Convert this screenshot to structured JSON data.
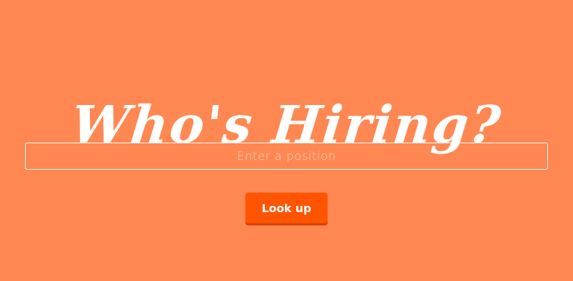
{
  "header": {
    "title": "Who's Hiring?"
  },
  "search": {
    "value": "",
    "placeholder": "Enter a position"
  },
  "actions": {
    "lookup_label": "Look up"
  },
  "colors": {
    "background": "#ff8852",
    "button": "#ff5500",
    "text": "#ffffff"
  }
}
